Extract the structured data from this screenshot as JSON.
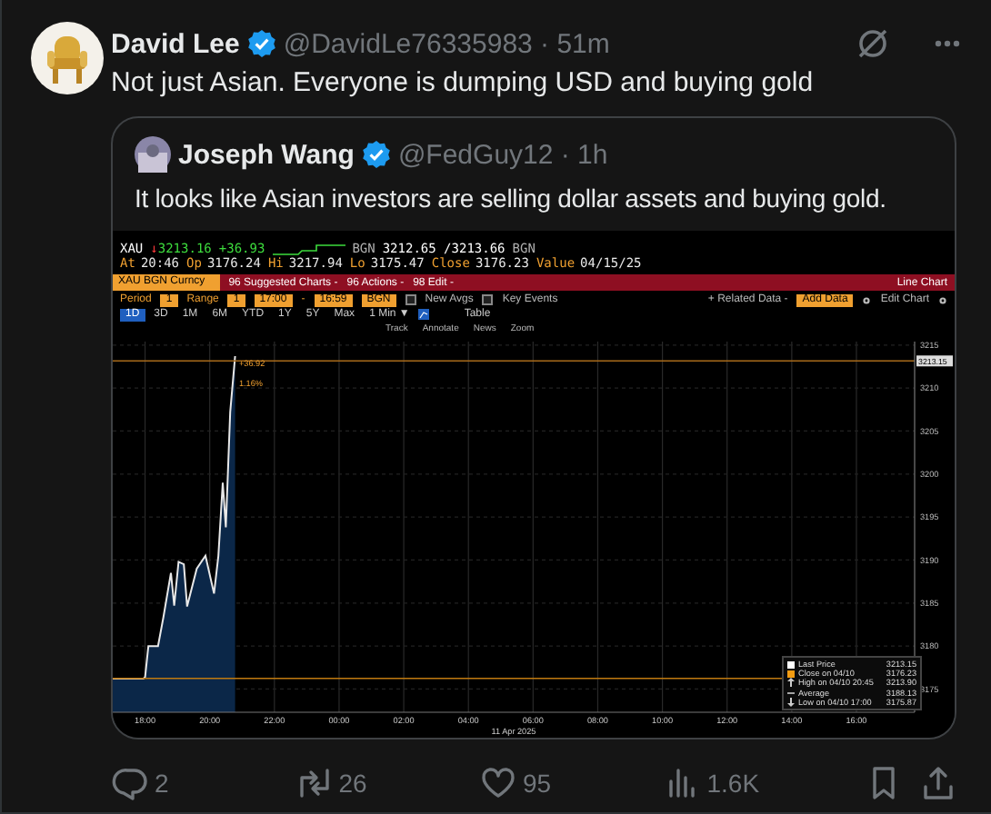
{
  "post": {
    "author": "David Lee",
    "meta": "@DavidLe76335983 · 51m",
    "text": "Not just Asian. Everyone is dumping USD and buying gold"
  },
  "quote": {
    "author": "Joseph Wang",
    "meta": "@FedGuy12 · 1h",
    "text": "It looks like Asian investors are selling dollar assets and buying gold."
  },
  "terminal": {
    "quote_row": [
      {
        "kind": "text",
        "text": "XAU",
        "color": "#ffffff"
      },
      {
        "kind": "text",
        "text": "↓",
        "color": "#ff3b3b"
      },
      {
        "kind": "text",
        "text": "3213.16",
        "color": "#3ddc3d"
      },
      {
        "kind": "text",
        "text": "+36.93",
        "color": "#3ddc3d"
      },
      {
        "kind": "sparkline"
      },
      {
        "kind": "text",
        "text": "BGN",
        "color": "#b0b0b0"
      },
      {
        "kind": "text",
        "text": "3212.65 /3213.66",
        "color": "#ffffff"
      },
      {
        "kind": "text",
        "text": "BGN",
        "color": "#b0b0b0"
      }
    ],
    "stats": [
      {
        "label": "At",
        "value": "20:46"
      },
      {
        "label": "Op",
        "value": "3176.24"
      },
      {
        "label": "Hi",
        "value": "3217.94"
      },
      {
        "label": "Lo",
        "value": "3175.47"
      },
      {
        "label": "Close",
        "value": "3176.23"
      },
      {
        "label": "Value",
        "value": "04/15/25"
      }
    ],
    "security": "XAU BGN Curncy",
    "menus": [
      "96 Suggested Charts -",
      "96 Actions -",
      "98 Edit -"
    ],
    "chart_type": "Line Chart",
    "controls": [
      {
        "kind": "label",
        "text": "Period"
      },
      {
        "kind": "field",
        "text": "1"
      },
      {
        "kind": "label",
        "text": "Range"
      },
      {
        "kind": "field",
        "text": "1"
      },
      {
        "kind": "field",
        "text": "17:00"
      },
      {
        "kind": "label",
        "text": "-"
      },
      {
        "kind": "field",
        "text": "16:59"
      },
      {
        "kind": "field",
        "text": "BGN"
      },
      {
        "kind": "check",
        "text": "New Avgs",
        "checked": false
      },
      {
        "kind": "check",
        "text": "Key Events",
        "checked": false
      }
    ],
    "right_controls": [
      {
        "kind": "menu",
        "text": "+ Related Data -"
      },
      {
        "kind": "field",
        "text": "Add Data"
      },
      {
        "kind": "menu",
        "text": "Edit Chart"
      }
    ],
    "ranges": [
      {
        "label": "1D",
        "selected": true
      },
      {
        "label": "3D",
        "selected": false
      },
      {
        "label": "1M",
        "selected": false
      },
      {
        "label": "6M",
        "selected": false
      },
      {
        "label": "YTD",
        "selected": false
      },
      {
        "label": "1Y",
        "selected": false
      },
      {
        "label": "5Y",
        "selected": false
      },
      {
        "label": "Max",
        "selected": false
      }
    ],
    "interval": "1 Min ▼",
    "view": "Table",
    "tools": [
      "Track",
      "Annotate",
      "News",
      "Zoom"
    ],
    "chart_data": {
      "type": "area",
      "xlabel": "11 Apr 2025",
      "grid": true,
      "x": [
        "2025-04-10T17:00",
        "2025-04-10T17:57",
        "2025-04-10T18:00",
        "2025-04-10T18:06",
        "2025-04-10T18:24",
        "2025-04-10T18:34",
        "2025-04-10T18:48",
        "2025-04-10T18:54",
        "2025-04-10T19:02",
        "2025-04-10T19:12",
        "2025-04-10T19:18",
        "2025-04-10T19:36",
        "2025-04-10T19:52",
        "2025-04-10T20:08",
        "2025-04-10T20:16",
        "2025-04-10T20:24",
        "2025-04-10T20:30",
        "2025-04-10T20:38",
        "2025-04-10T20:47"
      ],
      "series": [
        {
          "name": "Last Price",
          "color": "#e8e8e8",
          "values": [
            3176.2,
            3176.2,
            3176.4,
            3180,
            3180,
            3183.4,
            3188.5,
            3184.7,
            3189.8,
            3189.5,
            3184.6,
            3189,
            3190.5,
            3186.1,
            3190.5,
            3199,
            3193.8,
            3207.2,
            3213.7
          ]
        }
      ],
      "xlim": [
        "2025-04-10T17:00",
        "2025-04-11T17:48"
      ],
      "ylim": [
        3172.3,
        3215.4
      ],
      "xticks": [
        {
          "value": "2025-04-10T18:00",
          "label": "18:00"
        },
        {
          "value": "2025-04-10T20:00",
          "label": "20:00"
        },
        {
          "value": "2025-04-10T22:00",
          "label": "22:00"
        },
        {
          "value": "2025-04-11T00:00",
          "label": "00:00"
        },
        {
          "value": "2025-04-11T02:00",
          "label": "02:00"
        },
        {
          "value": "2025-04-11T04:00",
          "label": "04:00"
        },
        {
          "value": "2025-04-11T06:00",
          "label": "06:00"
        },
        {
          "value": "2025-04-11T08:00",
          "label": "08:00"
        },
        {
          "value": "2025-04-11T10:00",
          "label": "10:00"
        },
        {
          "value": "2025-04-11T12:00",
          "label": "12:00"
        },
        {
          "value": "2025-04-11T14:00",
          "label": "14:00"
        },
        {
          "value": "2025-04-11T16:00",
          "label": "16:00"
        }
      ],
      "yticks": [
        3175,
        3180,
        3185,
        3190,
        3195,
        3200,
        3205,
        3210,
        3215
      ],
      "ref_lines": [
        {
          "axis": "y",
          "value": 3176.23,
          "color": "#c07a10"
        },
        {
          "axis": "y",
          "value": 3213.15,
          "color": "#a86a1a"
        }
      ],
      "annotations": [
        {
          "text": "+36.92",
          "x": "2025-04-10T20:51",
          "y": 3213.3
        },
        {
          "text": "1.16%",
          "x": "2025-04-10T20:51",
          "y": 3211.0
        },
        "3213.15"
      ]
    },
    "legend": [
      {
        "kind": "swatch",
        "color": "#ffffff",
        "value": "3213.15"
      },
      {
        "kind": "swatch",
        "color": "#f39c12",
        "label": "Close on 04/10",
        "value": "3176.23"
      },
      {
        "kind": "high",
        "label": "High on 04/10 20:45",
        "value": "3213.90"
      },
      {
        "kind": "average",
        "label": "Average",
        "value": "3188.13"
      },
      {
        "kind": "low",
        "label": "Low on 04/10 17:00",
        "value": "3175.87"
      }
    ]
  },
  "actions": [
    {
      "kind": "reply",
      "count": "2"
    },
    {
      "kind": "repost",
      "count": "26"
    },
    {
      "kind": "like",
      "count": "95"
    },
    {
      "kind": "views",
      "count": "1.6K"
    },
    {
      "kind": "bookmark"
    },
    {
      "kind": "share"
    }
  ]
}
